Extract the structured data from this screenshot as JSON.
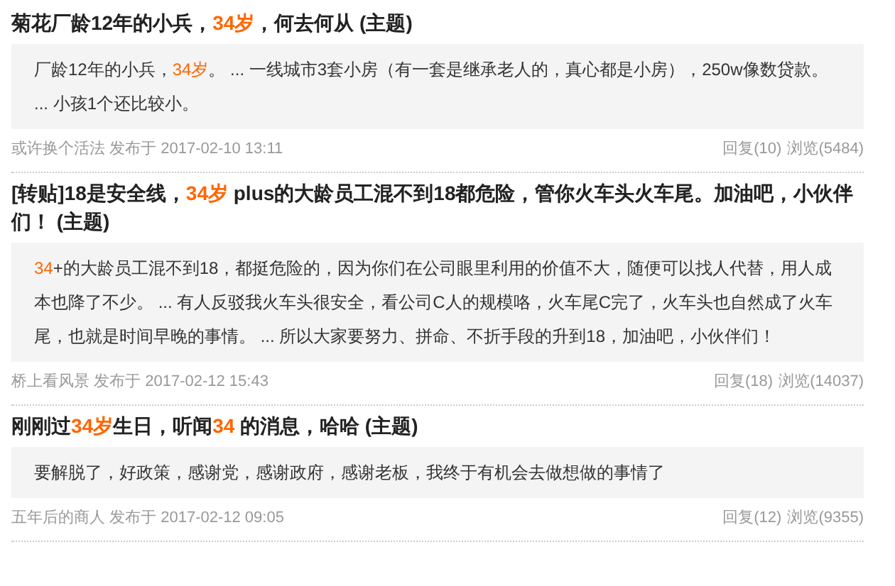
{
  "posts": [
    {
      "title": [
        {
          "text": "菊花厂龄12年的小兵，",
          "highlight": false
        },
        {
          "text": "34岁",
          "highlight": true
        },
        {
          "text": "，何去何从 (主题)",
          "highlight": false
        }
      ],
      "body": [
        {
          "text": "厂龄12年的小兵，",
          "highlight": false
        },
        {
          "text": "34岁",
          "highlight": true
        },
        {
          "text": "。 ... 一线城市3套小房（有一套是继承老人的，真心都是小房），250w像数贷款。 ... 小孩1个还比较小。",
          "highlight": false
        }
      ],
      "author": "或许换个活法",
      "posted": "发布于 2017-02-10 13:11",
      "replies": "回复(10)",
      "views": "浏览(5484)"
    },
    {
      "title": [
        {
          "text": "[转贴]18是安全线，",
          "highlight": false
        },
        {
          "text": "34岁",
          "highlight": true
        },
        {
          "text": " plus的大龄员工混不到18都危险，管你火车头火车尾。加油吧，小伙伴们！ (主题)",
          "highlight": false
        }
      ],
      "body": [
        {
          "text": "34",
          "highlight": true
        },
        {
          "text": "+的大龄员工混不到18，都挺危险的，因为你们在公司眼里利用的价值不大，随便可以找人代替，用人成本也降了不少。 ... 有人反驳我火车头很安全，看公司C人的规模咯，火车尾C完了，火车头也自然成了火车尾，也就是时间早晚的事情。 ... 所以大家要努力、拼命、不折手段的升到18，加油吧，小伙伴们！",
          "highlight": false
        }
      ],
      "author": "桥上看风景",
      "posted": "发布于 2017-02-12 15:43",
      "replies": "回复(18)",
      "views": "浏览(14037)"
    },
    {
      "title": [
        {
          "text": "刚刚过",
          "highlight": false
        },
        {
          "text": "34岁",
          "highlight": true
        },
        {
          "text": "生日，听闻",
          "highlight": false
        },
        {
          "text": "34",
          "highlight": true
        },
        {
          "text": " 的消息，哈哈 (主题)",
          "highlight": false
        }
      ],
      "body": [
        {
          "text": "要解脱了，好政策，感谢党，感谢政府，感谢老板，我终于有机会去做想做的事情了",
          "highlight": false
        }
      ],
      "author": "五年后的商人",
      "posted": "发布于 2017-02-12 09:05",
      "replies": "回复(12)",
      "views": "浏览(9355)"
    }
  ]
}
